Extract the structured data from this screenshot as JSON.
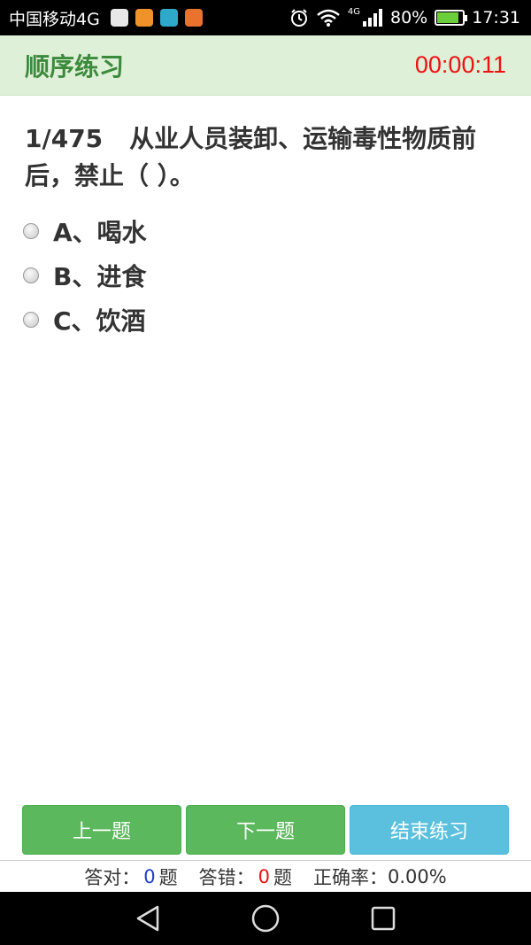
{
  "status_bar": {
    "carrier": "中国移动4G",
    "network": "4G",
    "battery": "80%",
    "battery_level": 0.8,
    "time": "17:31",
    "app_icons": [
      "app-icon-1",
      "app-icon-2",
      "app-icon-3",
      "app-icon-4"
    ],
    "app_icon_colors": [
      "#e8e8e8",
      "#f0922a",
      "#2fa9c9",
      "#e8722e"
    ]
  },
  "header": {
    "title": "顺序练习",
    "timer": "00:00:11",
    "title_color": "#3c8a3c",
    "timer_color": "#ee1111"
  },
  "question": {
    "number": "1/475",
    "text": "从业人员装卸、运输毒性物质前后，禁止（ ）。",
    "options": [
      {
        "label": "A、喝水"
      },
      {
        "label": "B、进食"
      },
      {
        "label": "C、饮酒"
      }
    ]
  },
  "buttons": {
    "prev": "上一题",
    "next": "下一题",
    "end": "结束练习"
  },
  "stats": {
    "correct_label": "答对：",
    "correct_count": "0",
    "correct_unit": "题",
    "wrong_label": "答错：",
    "wrong_count": "0",
    "wrong_unit": "题",
    "rate_label": "正确率：",
    "rate": "0.00%"
  },
  "nav": {
    "icons": [
      "back-icon",
      "home-icon",
      "recents-icon"
    ]
  }
}
